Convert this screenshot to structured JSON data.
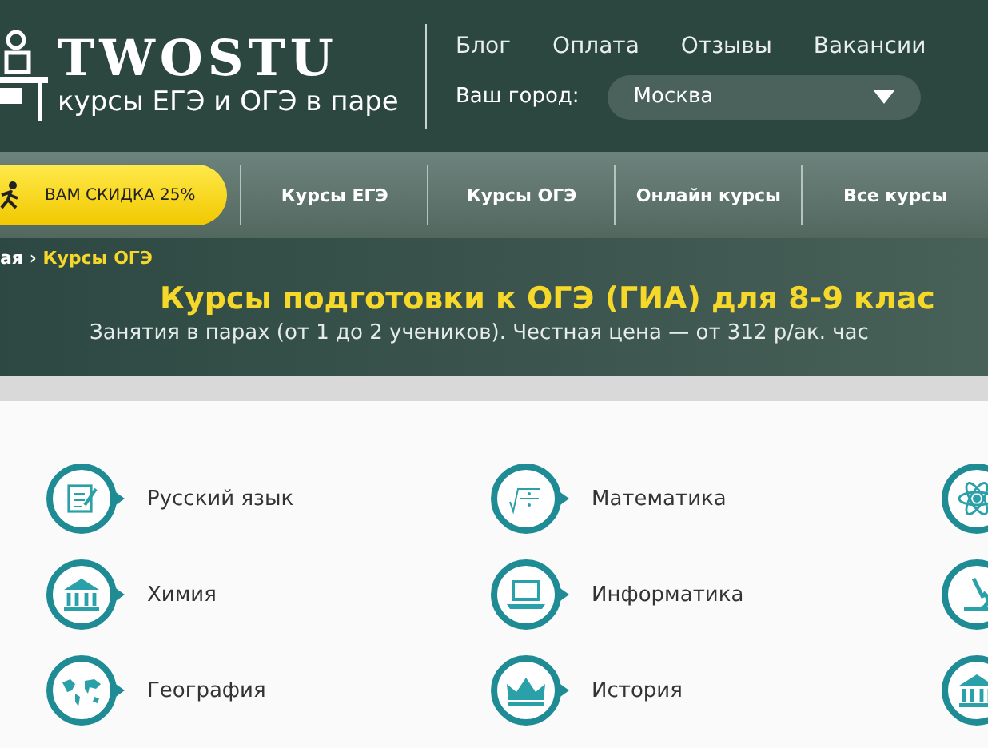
{
  "logo": {
    "name": "TWOSTU",
    "tagline": "курсы ЕГЭ и ОГЭ в паре"
  },
  "top_links": [
    "Блог",
    "Оплата",
    "Отзывы",
    "Вакансии"
  ],
  "city": {
    "label": "Ваш город:",
    "value": "Москва"
  },
  "promo": "ВАМ СКИДКА 25%",
  "menu": [
    "Курсы ЕГЭ",
    "Курсы ОГЭ",
    "Онлайн курсы",
    "Все курсы"
  ],
  "breadcrumb": {
    "parent": "ая",
    "separator": "›",
    "current": "Курсы ОГЭ"
  },
  "title": "Курсы подготовки к ОГЭ (ГИА) для 8-9 клас",
  "subtitle": "Занятия в парах (от 1 до 2 учеников). Честная цена — от 312 р/ак. час",
  "subjects": [
    {
      "label": "Русский язык",
      "kind": "notepad"
    },
    {
      "label": "Математика",
      "kind": "formula"
    },
    {
      "kind": "atom"
    },
    {
      "label": "Химия",
      "kind": "building"
    },
    {
      "label": "Информатика",
      "kind": "laptop"
    },
    {
      "kind": "microscope"
    },
    {
      "label": "География",
      "kind": "map"
    },
    {
      "label": "История",
      "kind": "crown"
    },
    {
      "kind": "building"
    }
  ]
}
